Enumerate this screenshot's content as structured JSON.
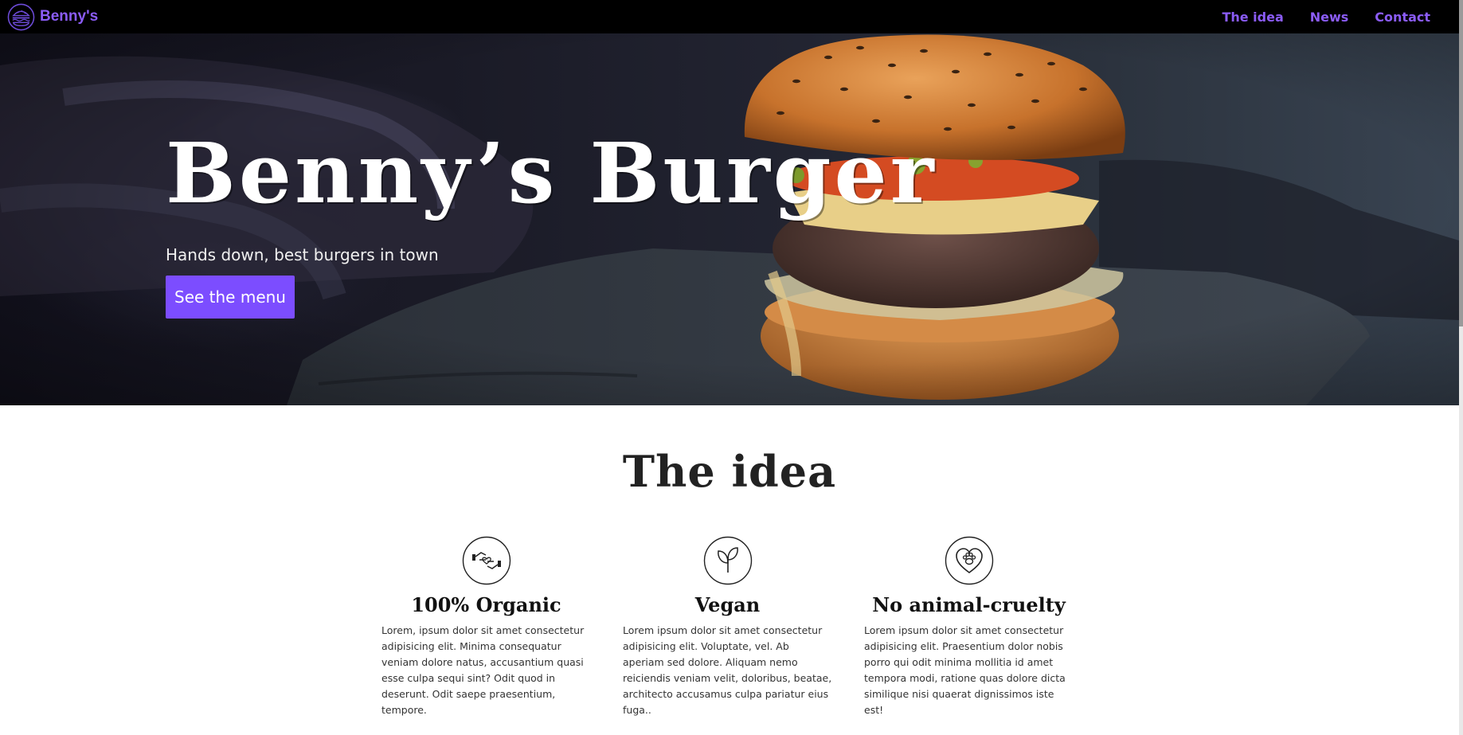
{
  "navbar": {
    "brand": "Benny's",
    "brand_icon": "burger-logo-icon",
    "links": [
      "The idea",
      "News",
      "Contact"
    ],
    "accent_color": "#8b5cf6"
  },
  "hero": {
    "title": "Benny’s Burger",
    "subtitle": "Hands down, best burgers in town",
    "button_label": "See the menu",
    "button_color": "#7c4dff"
  },
  "idea": {
    "title": "The idea",
    "features": [
      {
        "icon": "organic-hands-heart-icon",
        "title": "100% Organic",
        "text": "Lorem, ipsum dolor sit amet consectetur adipisicing elit. Minima consequatur veniam dolore natus, accusantium quasi esse culpa sequi sint? Odit quod in deserunt. Odit saepe praesentium, tempore."
      },
      {
        "icon": "plant-sprout-icon",
        "title": "Vegan",
        "text": "Lorem ipsum dolor sit amet consectetur adipisicing elit. Voluptate, vel. Ab aperiam sed dolore. Aliquam nemo reiciendis veniam velit, doloribus, beatae, architecto accusamus culpa pariatur eius fuga.."
      },
      {
        "icon": "heart-paw-icon",
        "title": "No animal-cruelty",
        "text": "Lorem ipsum dolor sit amet consectetur adipisicing elit. Praesentium dolor nobis porro qui odit minima mollitia id amet tempora modi, ratione quas dolore dicta similique nisi quaerat dignissimos iste est!"
      }
    ]
  }
}
